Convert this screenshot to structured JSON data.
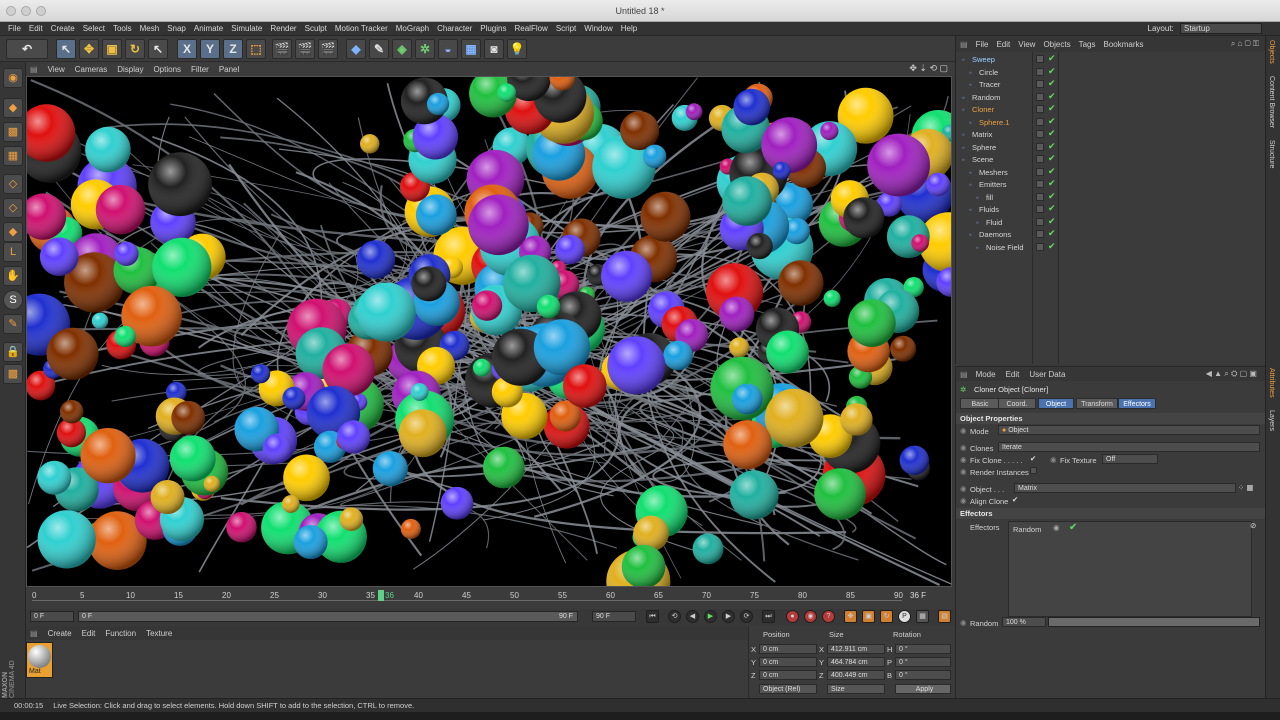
{
  "window": {
    "title": "Untitled 18 *"
  },
  "menubar": {
    "items": [
      "File",
      "Edit",
      "Create",
      "Select",
      "Tools",
      "Mesh",
      "Snap",
      "Animate",
      "Simulate",
      "Render",
      "Sculpt",
      "Motion Tracker",
      "MoGraph",
      "Character",
      "Plugins",
      "RealFlow",
      "Script",
      "Window",
      "Help"
    ],
    "layout_label": "Layout:",
    "layout_value": "Startup"
  },
  "toolbar": {
    "x_label": "X",
    "y_label": "Y",
    "z_label": "Z"
  },
  "viewport": {
    "menu": [
      "View",
      "Cameras",
      "Display",
      "Options",
      "Filter",
      "Panel"
    ]
  },
  "timeline": {
    "ticks": [
      "0",
      "5",
      "10",
      "15",
      "20",
      "25",
      "30",
      "35",
      "36",
      "40",
      "45",
      "50",
      "55",
      "60",
      "65",
      "70",
      "75",
      "80",
      "85",
      "90"
    ],
    "current_frame": "36 F",
    "start_field": "0 F",
    "range_start": "0 F",
    "range_end": "90 F",
    "end_field": "90 F"
  },
  "material_manager": {
    "menu": [
      "Create",
      "Edit",
      "Function",
      "Texture"
    ],
    "material_name": "Mat"
  },
  "coordinates": {
    "headers": [
      "Position",
      "Size",
      "Rotation"
    ],
    "rows": [
      {
        "axis": "X",
        "pos": "0 cm",
        "size_axis": "X",
        "size": "412.911 cm",
        "rot_axis": "H",
        "rot": "0 °"
      },
      {
        "axis": "Y",
        "pos": "0 cm",
        "size_axis": "Y",
        "size": "464.784 cm",
        "rot_axis": "P",
        "rot": "0 °"
      },
      {
        "axis": "Z",
        "pos": "0 cm",
        "size_axis": "Z",
        "size": "400.449 cm",
        "rot_axis": "B",
        "rot": "0 °"
      }
    ],
    "mode": "Object (Rel)",
    "size_mode": "Size",
    "apply": "Apply"
  },
  "status": {
    "time": "00:00:15",
    "message": "Live Selection: Click and drag to select elements. Hold down SHIFT to add to the selection, CTRL to remove."
  },
  "object_manager": {
    "menu": [
      "File",
      "Edit",
      "View",
      "Objects",
      "Tags",
      "Bookmarks"
    ],
    "items": [
      {
        "name": "Sweep",
        "indent": 0,
        "color": "#9ad0ff"
      },
      {
        "name": "Circle",
        "indent": 1,
        "color": "#d6d6d6"
      },
      {
        "name": "Tracer",
        "indent": 1,
        "color": "#d6d6d6"
      },
      {
        "name": "Random",
        "indent": 0,
        "color": "#d6d6d6"
      },
      {
        "name": "Cloner",
        "indent": 0,
        "color": "#f0a040"
      },
      {
        "name": "Sphere.1",
        "indent": 1,
        "color": "#f0a040"
      },
      {
        "name": "Matrix",
        "indent": 0,
        "color": "#d6d6d6"
      },
      {
        "name": "Sphere",
        "indent": 0,
        "color": "#d6d6d6"
      },
      {
        "name": "Scene",
        "indent": 0,
        "color": "#d6d6d6"
      },
      {
        "name": "Meshers",
        "indent": 1,
        "color": "#d6d6d6"
      },
      {
        "name": "Emitters",
        "indent": 1,
        "color": "#d6d6d6"
      },
      {
        "name": "fill",
        "indent": 2,
        "color": "#d6d6d6"
      },
      {
        "name": "Fluids",
        "indent": 1,
        "color": "#d6d6d6"
      },
      {
        "name": "Fluid",
        "indent": 2,
        "color": "#d6d6d6"
      },
      {
        "name": "Daemons",
        "indent": 1,
        "color": "#d6d6d6"
      },
      {
        "name": "Noise Field",
        "indent": 2,
        "color": "#d6d6d6"
      }
    ]
  },
  "attributes": {
    "menu": [
      "Mode",
      "Edit",
      "User Data"
    ],
    "object_title": "Cloner Object [Cloner]",
    "tabs": [
      "Basic",
      "Coord.",
      "Object",
      "Transform",
      "Effectors"
    ],
    "section_properties": "Object Properties",
    "mode_label": "Mode",
    "mode_value": "Object",
    "clones_label": "Clones",
    "clones_value": "Iterate",
    "fix_clone_label": "Fix Clone . . . . .",
    "fix_texture_label": "Fix Texture",
    "fix_texture_value": "Off",
    "render_instances_label": "Render Instances",
    "object_label": "Object . . .",
    "object_value": "Matrix",
    "align_clone_label": "Align Clone",
    "section_effectors": "Effectors",
    "effectors_label": "Effectors",
    "effector_item": "Random",
    "random_label": "Random",
    "random_value": "100 %"
  },
  "right_strip": {
    "tabs": [
      "Objects",
      "Content Browser",
      "Structure",
      "Attributes",
      "Layers"
    ]
  },
  "brand": {
    "line1": "MAXON",
    "line2": "CINEMA 4D"
  }
}
